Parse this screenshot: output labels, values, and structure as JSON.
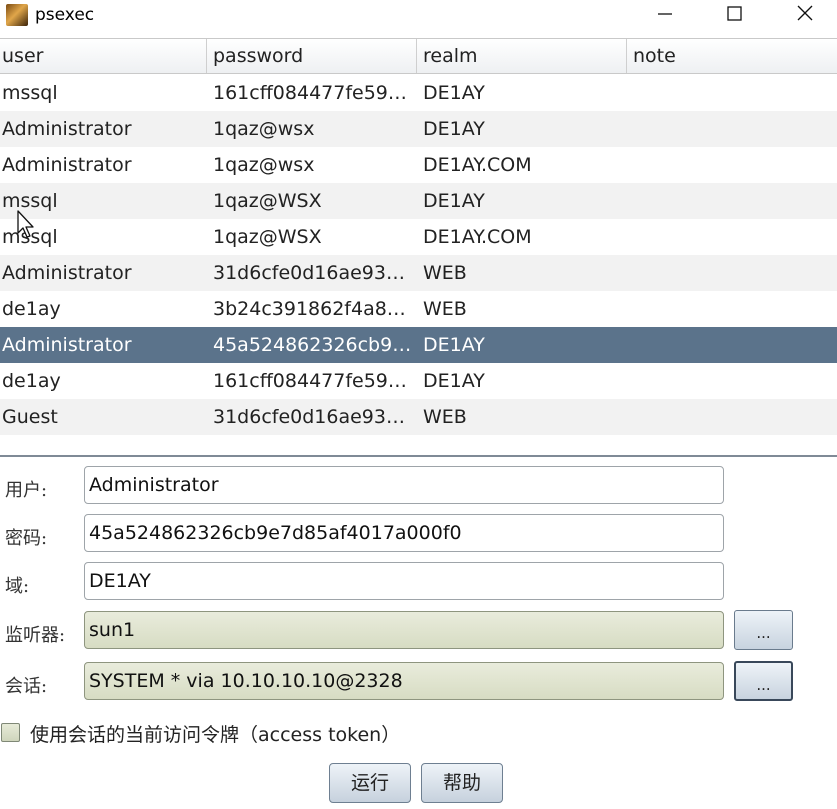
{
  "window": {
    "title": "psexec"
  },
  "table": {
    "columns": [
      "user",
      "password",
      "realm",
      "note"
    ],
    "rows": [
      {
        "user": "mssql",
        "password": "161cff084477fe59…",
        "realm": "DE1AY",
        "note": ""
      },
      {
        "user": "Administrator",
        "password": "1qaz@wsx",
        "realm": "DE1AY",
        "note": ""
      },
      {
        "user": "Administrator",
        "password": "1qaz@wsx",
        "realm": "DE1AY.COM",
        "note": ""
      },
      {
        "user": "mssql",
        "password": "1qaz@WSX",
        "realm": "DE1AY",
        "note": ""
      },
      {
        "user": "mssql",
        "password": "1qaz@WSX",
        "realm": "DE1AY.COM",
        "note": ""
      },
      {
        "user": "Administrator",
        "password": "31d6cfe0d16ae93…",
        "realm": "WEB",
        "note": ""
      },
      {
        "user": "de1ay",
        "password": "3b24c391862f4a8…",
        "realm": "WEB",
        "note": ""
      },
      {
        "user": "Administrator",
        "password": "45a524862326cb9…",
        "realm": "DE1AY",
        "note": ""
      },
      {
        "user": "de1ay",
        "password": "161cff084477fe59…",
        "realm": "DE1AY",
        "note": ""
      },
      {
        "user": "Guest",
        "password": "31d6cfe0d16ae93…",
        "realm": "WEB",
        "note": ""
      }
    ],
    "selected_row": 7
  },
  "form": {
    "user_label": "用户:",
    "user_value": "Administrator",
    "password_label": "密码:",
    "password_value": "45a524862326cb9e7d85af4017a000f0",
    "domain_label": "域:",
    "domain_value": "DE1AY",
    "listener_label": "监听器:",
    "listener_value": "sun1",
    "listener_browse": "...",
    "session_label": "会话:",
    "session_value": "SYSTEM * via  10.10.10.10@2328",
    "session_browse": "...",
    "token_checkbox_label": "使用会话的当前访问令牌（access token）",
    "token_checked": false,
    "run_label": "运行",
    "help_label": "帮助"
  },
  "colors": {
    "selection": "#5b738b",
    "field_disabled": "#dde1cb"
  },
  "icons": {
    "app": "app-icon",
    "minimize": "minimize-icon",
    "maximize": "maximize-icon",
    "close": "close-icon",
    "cursor": "mouse-cursor-icon"
  }
}
